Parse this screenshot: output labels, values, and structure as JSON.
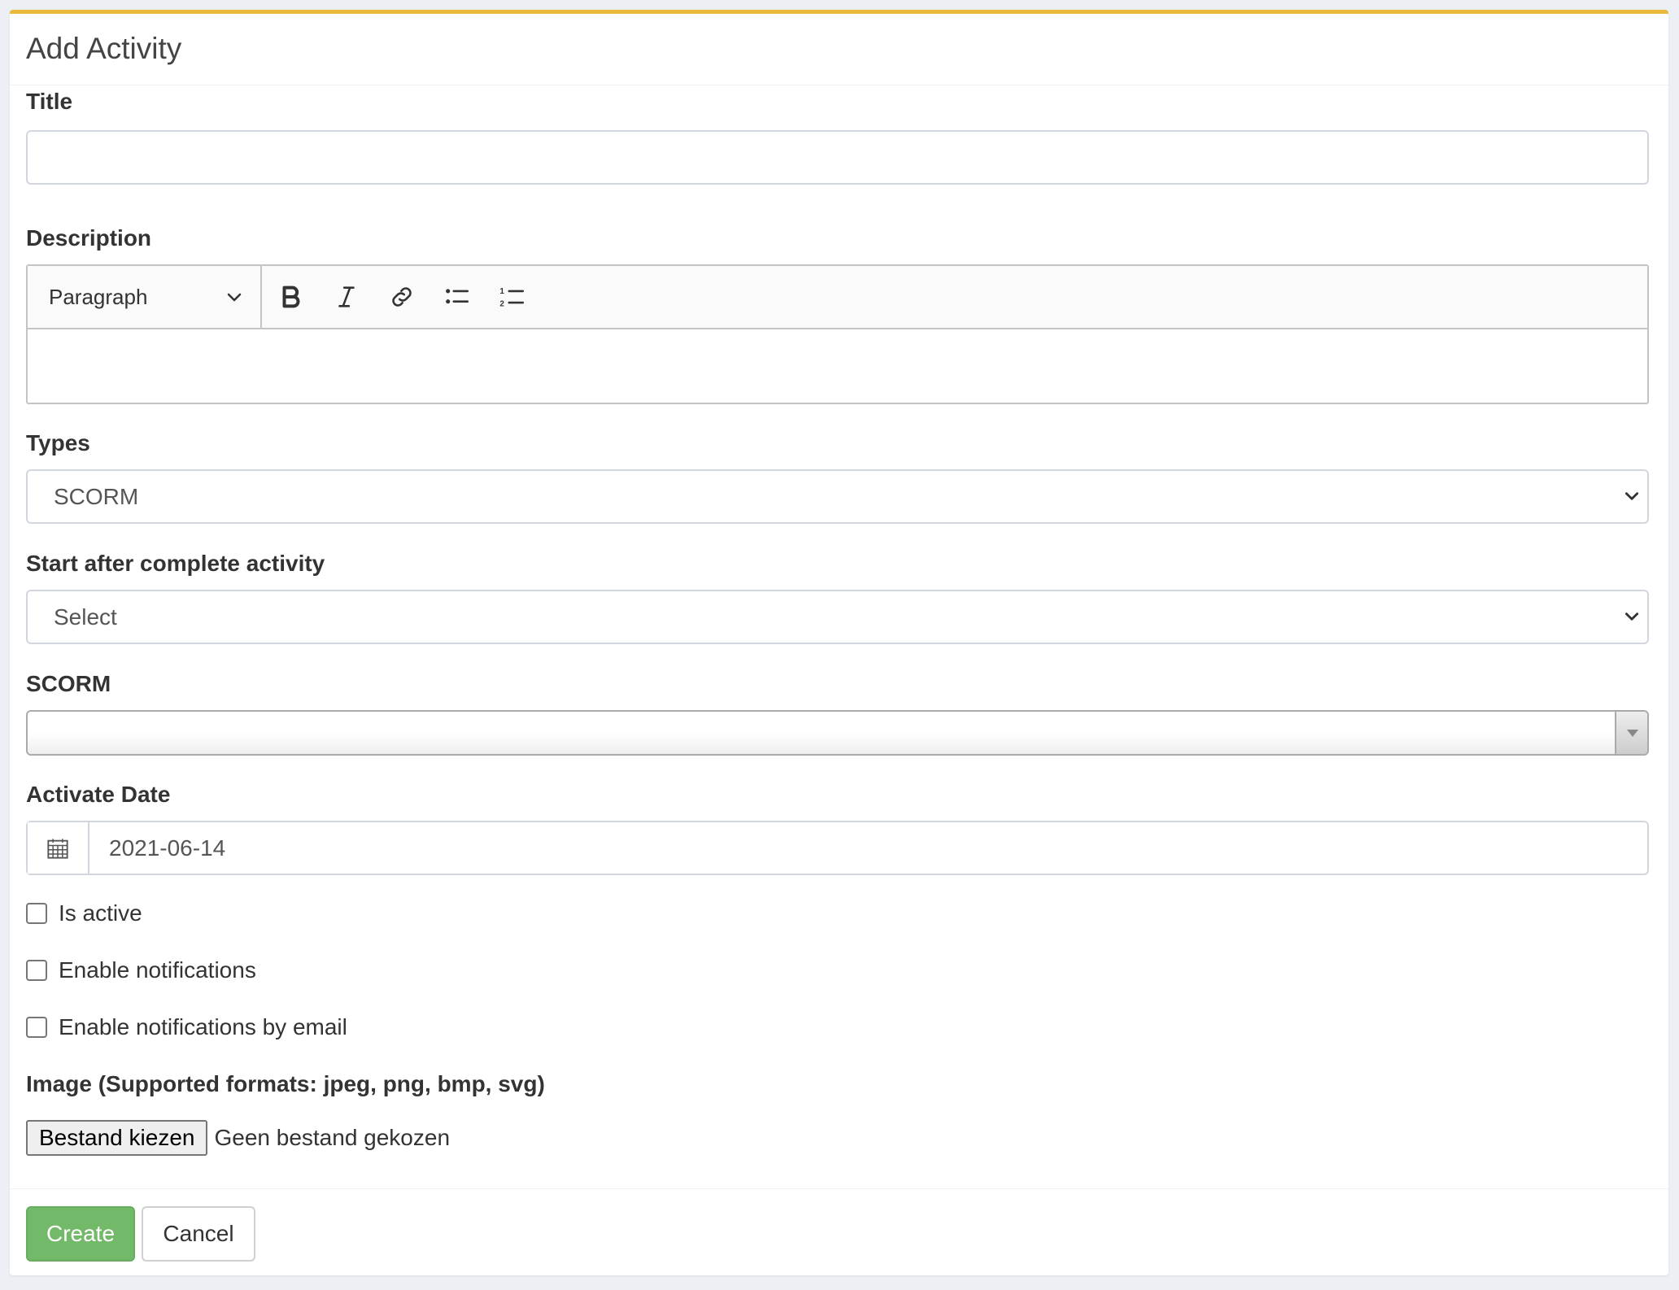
{
  "header": {
    "title": "Add Activity"
  },
  "form": {
    "title": {
      "label": "Title",
      "value": ""
    },
    "description": {
      "label": "Description",
      "heading_select": "Paragraph",
      "tools": [
        "bold-icon",
        "italic-icon",
        "link-icon",
        "bulleted-list-icon",
        "numbered-list-icon"
      ]
    },
    "types": {
      "label": "Types",
      "selected": "SCORM"
    },
    "start_after": {
      "label": "Start after complete activity",
      "selected": "Select"
    },
    "scorm": {
      "label": "SCORM",
      "selected": ""
    },
    "activate_date": {
      "label": "Activate Date",
      "value": "2021-06-14"
    },
    "checkboxes": [
      {
        "label": "Is active",
        "checked": false
      },
      {
        "label": "Enable notifications",
        "checked": false
      },
      {
        "label": "Enable notifications by email",
        "checked": false
      }
    ],
    "image": {
      "label": "Image (Supported formats: jpeg, png, bmp, svg)",
      "button": "Bestand kiezen",
      "status": "Geen bestand gekozen"
    }
  },
  "footer": {
    "create": "Create",
    "cancel": "Cancel"
  },
  "colors": {
    "accent_top": "#e8b93b",
    "create_button": "#73b96a"
  }
}
